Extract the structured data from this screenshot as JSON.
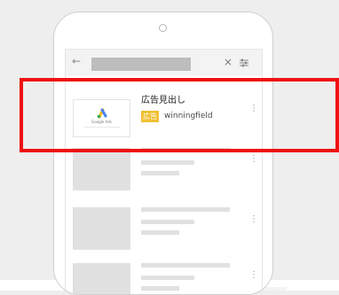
{
  "search": {
    "placeholder": ""
  },
  "toolbar": {
    "close_glyph": "×"
  },
  "ad": {
    "headline": "広告見出し",
    "badge": "広告",
    "domain": "winningfield",
    "thumbnail_caption": "Google Ads"
  },
  "placeholder_results_count": 3,
  "colors": {
    "highlight": "#ee1111",
    "ad_badge": "#f0c033",
    "placeholder": "#e1e1e1",
    "google_blue": "#4285f4",
    "google_yellow": "#fbbc04",
    "google_green": "#34a853"
  },
  "icons": {
    "back": "arrow-left-icon",
    "close": "close-icon",
    "filter": "filter-sliders-icon",
    "more": "more-vertical-icon"
  }
}
